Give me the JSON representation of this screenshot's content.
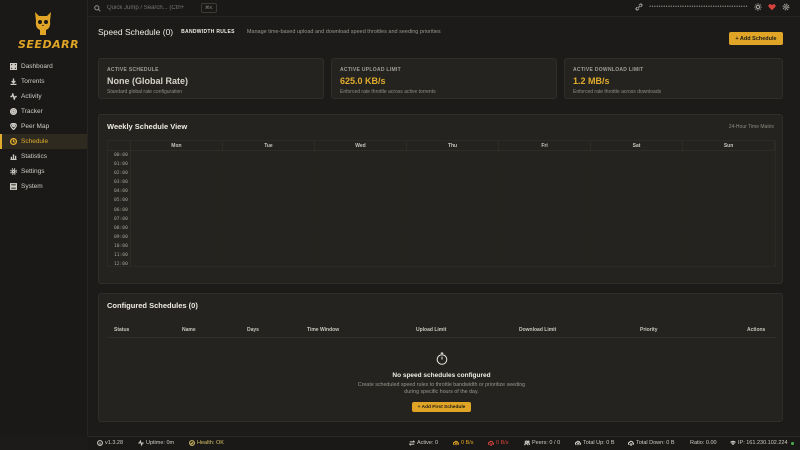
{
  "brand": {
    "logo_text": "SEEDARR"
  },
  "nav": [
    {
      "id": "dashboard",
      "label": "Dashboard",
      "icon": "grid-icon"
    },
    {
      "id": "torrents",
      "label": "Torrents",
      "icon": "download-icon"
    },
    {
      "id": "activity",
      "label": "Activity",
      "icon": "activity-icon"
    },
    {
      "id": "tracker",
      "label": "Tracker",
      "icon": "target-icon"
    },
    {
      "id": "peer-map",
      "label": "Peer Map",
      "icon": "map-icon"
    },
    {
      "id": "schedule",
      "label": "Schedule",
      "icon": "clock-icon",
      "active": true
    },
    {
      "id": "statistics",
      "label": "Statistics",
      "icon": "bar-chart-icon"
    },
    {
      "id": "settings",
      "label": "Settings",
      "icon": "gear-icon"
    },
    {
      "id": "system",
      "label": "System",
      "icon": "server-icon"
    }
  ],
  "topbar": {
    "search_placeholder": "Quick Jump / Search... (Ctrl+",
    "kbd": "⌘K",
    "masked": "••••••••••••••••••••••••••••••••••••••••••"
  },
  "header": {
    "title": "Speed Schedule (0)",
    "tag": "BANDWIDTH RULES",
    "description": "Manage time-based upload and download speed throttles and seeding priorities",
    "add_button": "+ Add Schedule"
  },
  "stats": [
    {
      "label": "ACTIVE SCHEDULE",
      "value": "None (Global Rate)",
      "sub": "Standard global rate configuration",
      "accent": false
    },
    {
      "label": "ACTIVE UPLOAD LIMIT",
      "value": "625.0 KB/s",
      "sub": "Enforced rate throttle across active torrents",
      "accent": true
    },
    {
      "label": "ACTIVE DOWNLOAD LIMIT",
      "value": "1.2 MB/s",
      "sub": "Enforced rate throttle across downloads",
      "accent": true
    }
  ],
  "weekly": {
    "title": "Weekly Schedule View",
    "note": "24-Hour Time Matrix",
    "days": [
      "Mon",
      "Tue",
      "Wed",
      "Thu",
      "Fri",
      "Sat",
      "Sun"
    ],
    "hours": [
      "00:00",
      "01:00",
      "02:00",
      "03:00",
      "04:00",
      "05:00",
      "06:00",
      "07:00",
      "08:00",
      "09:00",
      "10:00",
      "11:00",
      "12:00"
    ]
  },
  "configured": {
    "title": "Configured Schedules (0)",
    "columns": [
      "Status",
      "Name",
      "Days",
      "Time Window",
      "Upload Limit",
      "Download Limit",
      "Priority",
      "Actions"
    ],
    "empty_title": "No speed schedules configured",
    "empty_desc": "Create scheduled speed rules to throttle bandwidth or prioritize seeding during specific hours of the day.",
    "empty_button": "+ Add First Schedule"
  },
  "footer": {
    "version": "v1.3.28",
    "uptime": "Uptime: 0m",
    "health": "Health: OK",
    "active": "Active: 0",
    "up_rate": "0 B/s",
    "down_rate": "0 B/s",
    "peers": "Peers: 0 / 0",
    "total_up": "Total Up: 0 B",
    "total_down": "Total Down: 0 B",
    "ratio": "Ratio: 0.00",
    "ip": "IP: 161.230.102.224"
  },
  "colors": {
    "accent": "#e0a526",
    "background": "#1c1b19",
    "card": "#24231f",
    "danger": "#d8433c",
    "ok": "#4caf50"
  }
}
